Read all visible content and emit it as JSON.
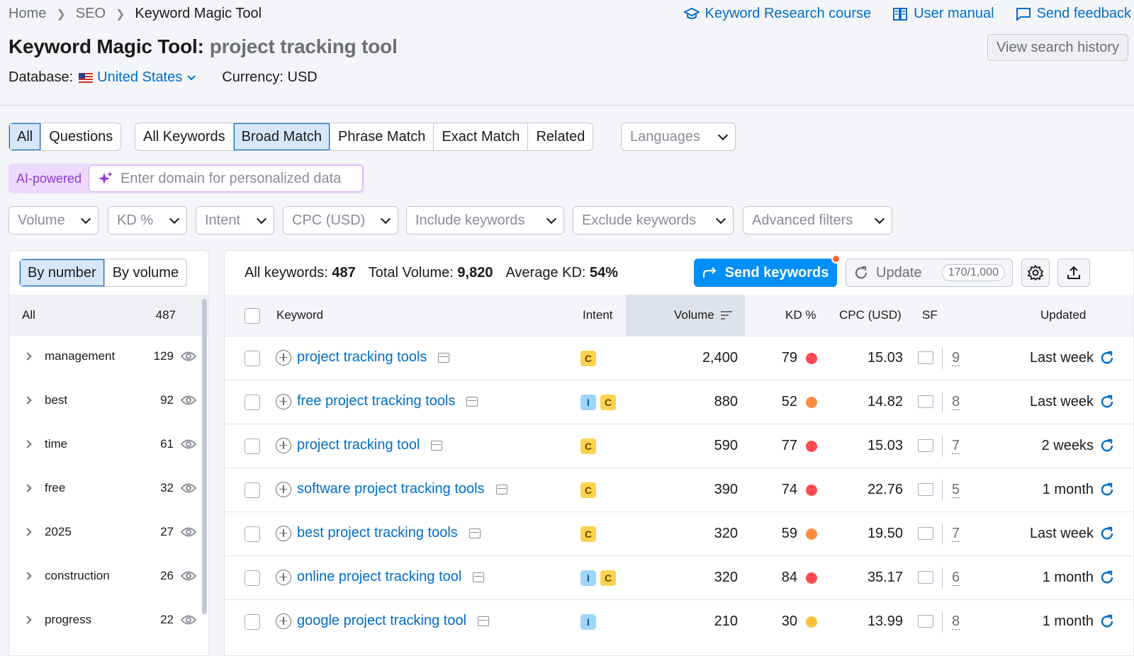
{
  "breadcrumb": [
    "Home",
    "SEO",
    "Keyword Magic Tool"
  ],
  "toplinks": {
    "course": "Keyword Research course",
    "manual": "User manual",
    "feedback": "Send feedback"
  },
  "title": {
    "tool": "Keyword Magic Tool:",
    "query": "project tracking tool"
  },
  "history_button": "View search history",
  "database": {
    "label": "Database:",
    "value": "United States",
    "currency": "Currency: USD"
  },
  "match_tabs": {
    "group1": [
      "All",
      "Questions"
    ],
    "group2": [
      "All Keywords",
      "Broad Match",
      "Phrase Match",
      "Exact Match",
      "Related"
    ],
    "languages": "Languages"
  },
  "ai": {
    "label": "AI-powered",
    "placeholder": "Enter domain for personalized data"
  },
  "filters": [
    "Volume",
    "KD %",
    "Intent",
    "CPC (USD)",
    "Include keywords",
    "Exclude keywords",
    "Advanced filters"
  ],
  "left_panel": {
    "toggle": [
      "By number",
      "By volume"
    ],
    "all": {
      "label": "All",
      "count": "487"
    },
    "groups": [
      {
        "name": "management",
        "count": "129"
      },
      {
        "name": "best",
        "count": "92"
      },
      {
        "name": "time",
        "count": "61"
      },
      {
        "name": "free",
        "count": "32"
      },
      {
        "name": "2025",
        "count": "27"
      },
      {
        "name": "construction",
        "count": "26"
      },
      {
        "name": "progress",
        "count": "22"
      }
    ]
  },
  "stats": {
    "all_label": "All keywords:",
    "all_value": "487",
    "vol_label": "Total Volume:",
    "vol_value": "9,820",
    "kd_label": "Average KD:",
    "kd_value": "54%"
  },
  "actions": {
    "send": "Send keywords",
    "update": "Update",
    "quota": "170/1,000"
  },
  "table": {
    "headers": {
      "keyword": "Keyword",
      "intent": "Intent",
      "volume": "Volume",
      "kd": "KD %",
      "cpc": "CPC (USD)",
      "sf": "SF",
      "updated": "Updated"
    },
    "rows": [
      {
        "keyword": "project tracking tools",
        "intent": [
          "C"
        ],
        "volume": "2,400",
        "kd": "79",
        "kd_color": "#ff4953",
        "cpc": "15.03",
        "sf": "9",
        "updated": "Last week"
      },
      {
        "keyword": "free project tracking tools",
        "intent": [
          "I",
          "C"
        ],
        "volume": "880",
        "kd": "52",
        "kd_color": "#ff8c43",
        "cpc": "14.82",
        "sf": "8",
        "updated": "Last week"
      },
      {
        "keyword": "project tracking tool",
        "intent": [
          "C"
        ],
        "volume": "590",
        "kd": "77",
        "kd_color": "#ff4953",
        "cpc": "15.03",
        "sf": "7",
        "updated": "2 weeks"
      },
      {
        "keyword": "software project tracking tools",
        "intent": [
          "C"
        ],
        "volume": "390",
        "kd": "74",
        "kd_color": "#ff4953",
        "cpc": "22.76",
        "sf": "5",
        "updated": "1 month"
      },
      {
        "keyword": "best project tracking tools",
        "intent": [
          "C"
        ],
        "volume": "320",
        "kd": "59",
        "kd_color": "#ff8c43",
        "cpc": "19.50",
        "sf": "7",
        "updated": "Last week"
      },
      {
        "keyword": "online project tracking tool",
        "intent": [
          "I",
          "C"
        ],
        "volume": "320",
        "kd": "84",
        "kd_color": "#ff4953",
        "cpc": "35.17",
        "sf": "6",
        "updated": "1 month"
      },
      {
        "keyword": "google project tracking tool",
        "intent": [
          "I"
        ],
        "volume": "210",
        "kd": "30",
        "kd_color": "#fdc23c",
        "cpc": "13.99",
        "sf": "8",
        "updated": "1 month"
      }
    ]
  }
}
